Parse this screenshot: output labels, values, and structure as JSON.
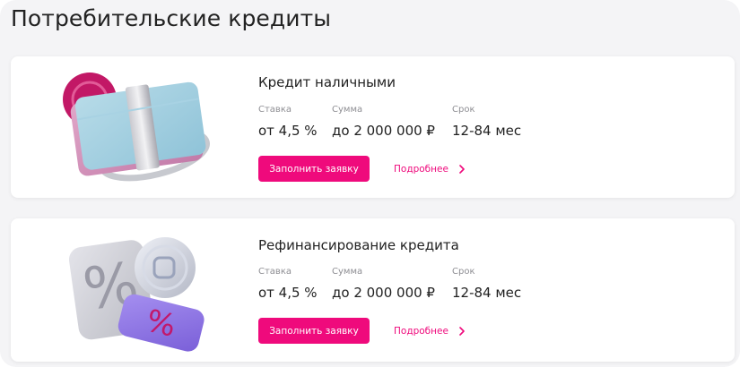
{
  "page": {
    "title": "Потребительские кредиты"
  },
  "colors": {
    "accent": "#ef0a7c",
    "muted": "#8e8e93",
    "text": "#1f1f1f",
    "background": "#f4f4f6"
  },
  "cards": [
    {
      "title": "Кредит наличными",
      "image_icon": "cash-card-illustration",
      "rate_label": "Ставка",
      "rate_value": "от 4,5 %",
      "amount_label": "Сумма",
      "amount_value": "до 2 000 000 ₽",
      "term_label": "Срок",
      "term_value": "12-84 мес",
      "apply_label": "Заполнить заявку",
      "more_label": "Подробнее"
    },
    {
      "title": "Рефинансирование кредита",
      "image_icon": "percent-refinance-illustration",
      "rate_label": "Ставка",
      "rate_value": "от 4,5 %",
      "amount_label": "Сумма",
      "amount_value": "до 2 000 000 ₽",
      "term_label": "Срок",
      "term_value": "12-84 мес",
      "apply_label": "Заполнить заявку",
      "more_label": "Подробнее"
    }
  ]
}
